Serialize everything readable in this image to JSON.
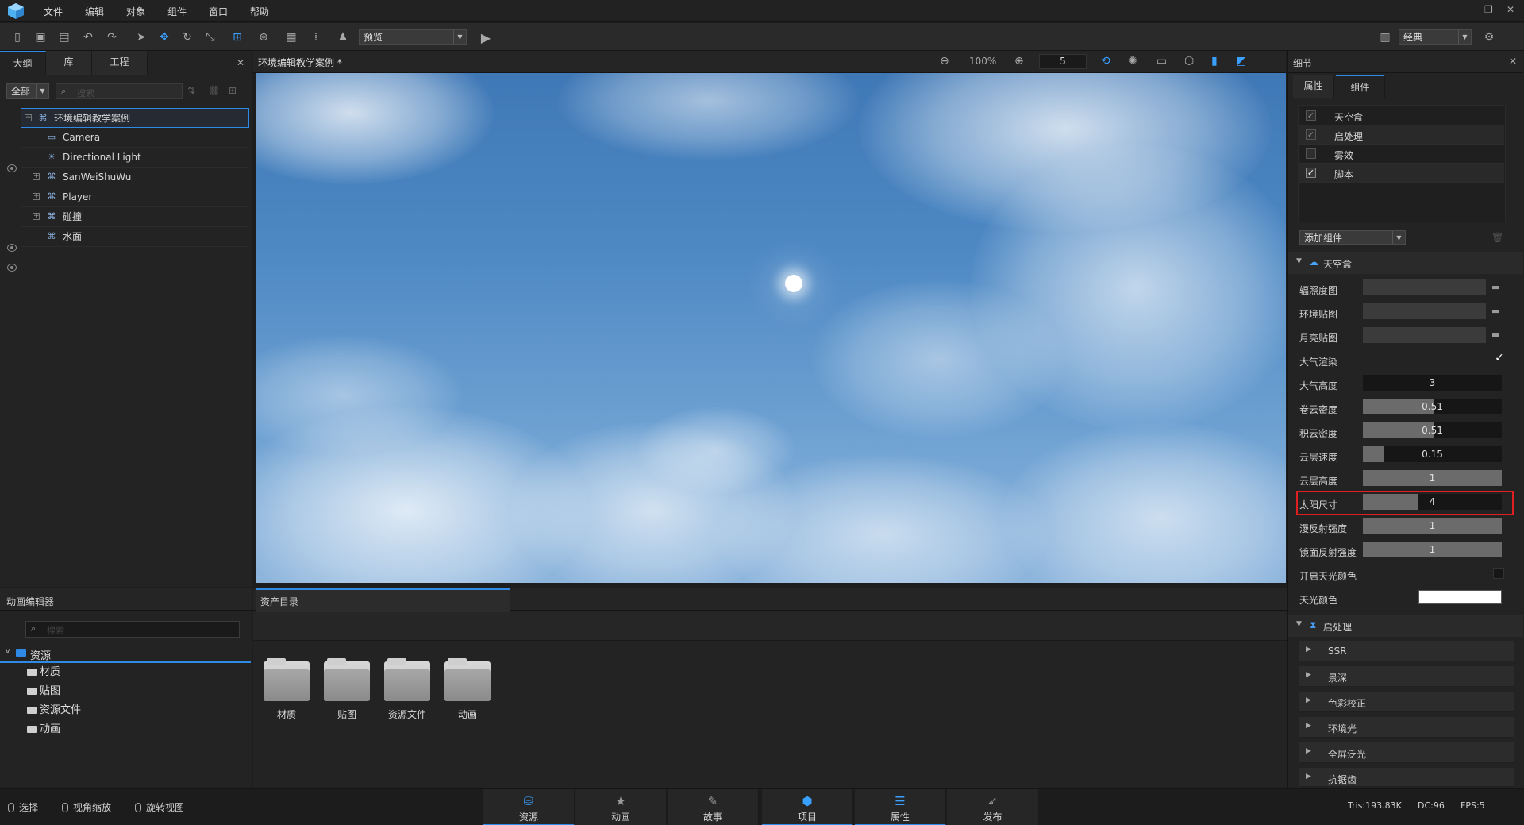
{
  "menu": {
    "items": [
      "文件",
      "编辑",
      "对象",
      "组件",
      "窗口",
      "帮助"
    ]
  },
  "toolbar": {
    "mode_select": "预览",
    "layout_select": "经典"
  },
  "outline": {
    "tabs": [
      "大纲",
      "库",
      "工程"
    ],
    "filter": "全部",
    "search_placeholder": "搜索",
    "tree": [
      {
        "label": "环境编辑教学案例",
        "icon": "group-icon"
      },
      {
        "label": "Camera",
        "icon": "camera-icon"
      },
      {
        "label": "Directional Light",
        "icon": "light-icon"
      },
      {
        "label": "SanWeiShuWu",
        "icon": "group-icon"
      },
      {
        "label": "Player",
        "icon": "group-icon"
      },
      {
        "label": "碰撞",
        "icon": "group-icon"
      },
      {
        "label": "水面",
        "icon": "group-icon"
      }
    ]
  },
  "viewport": {
    "title": "环境编辑教学案例 *",
    "zoom": "100%",
    "speed": "5"
  },
  "details": {
    "title": "细节",
    "tabs": [
      "属性",
      "组件"
    ],
    "components": [
      {
        "label": "天空盒",
        "checked": true
      },
      {
        "label": "启处理",
        "checked": true
      },
      {
        "label": "雾效",
        "checked": false
      },
      {
        "label": "脚本",
        "checked": true
      }
    ],
    "add_component": "添加组件",
    "skybox_section": "天空盒",
    "props": {
      "irradiance_map": "辐照度图",
      "env_map": "环境贴图",
      "moon_map": "月亮贴图",
      "atmosphere_render": "大气渲染",
      "atmosphere_height": {
        "label": "大气高度",
        "value": "3"
      },
      "cirrus_density": {
        "label": "卷云密度",
        "value": "0.51",
        "fill": 0.51
      },
      "cumulus_density": {
        "label": "积云密度",
        "value": "0.51",
        "fill": 0.51
      },
      "cloud_speed": {
        "label": "云层速度",
        "value": "0.15",
        "fill": 0.15
      },
      "cloud_height": {
        "label": "云层高度",
        "value": "1",
        "fill": 1.0
      },
      "sun_size": {
        "label": "太阳尺寸",
        "value": "4",
        "fill": 0.4
      },
      "diffuse_strength": {
        "label": "漫反射强度",
        "value": "1",
        "fill": 1.0
      },
      "specular_strength": {
        "label": "镜面反射强度",
        "value": "1",
        "fill": 1.0
      },
      "enable_skylight_color": "开启天光颜色",
      "skylight_color": {
        "label": "天光颜色",
        "color": "#ffffff"
      }
    },
    "post_section": "启处理",
    "post_items": [
      "SSR",
      "景深",
      "色彩校正",
      "环境光",
      "全屏泛光",
      "抗锯齿"
    ]
  },
  "anim_panel": {
    "title": "动画编辑器",
    "search_placeholder": "搜索",
    "root": "资源",
    "children": [
      "材质",
      "贴图",
      "资源文件",
      "动画"
    ]
  },
  "asset_panel": {
    "title": "资产目录",
    "folders": [
      "材质",
      "贴图",
      "资源文件",
      "动画"
    ]
  },
  "statusbar": {
    "tools": [
      "选择",
      "视角缩放",
      "旋转视图"
    ],
    "modules": [
      "资源",
      "动画",
      "故事",
      "项目",
      "属性",
      "发布"
    ],
    "tris": "Tris:193.83K",
    "dc": "DC:96",
    "fps": "FPS:5"
  },
  "colors": {
    "accent": "#2f8ae6",
    "highlight_border": "#e02020",
    "panel_bg": "#232323"
  }
}
